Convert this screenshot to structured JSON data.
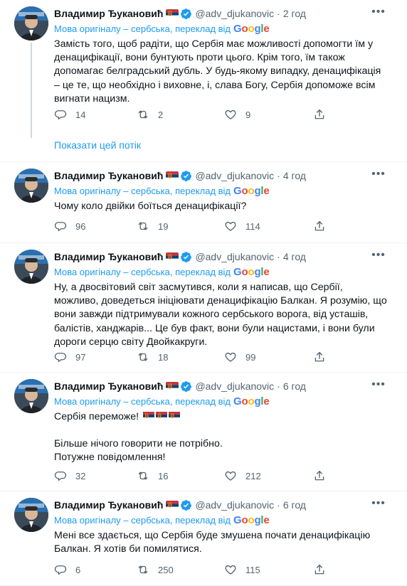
{
  "translate_label": "Мова оригіналу – сербська, переклад від",
  "google": [
    "G",
    "o",
    "o",
    "g",
    "l",
    "e"
  ],
  "show_thread": "Показати цей потік",
  "tweets": [
    {
      "name": "Владимир Ђукановић",
      "handle": "@adv_djukanovic",
      "time": "2 год",
      "text": [
        "Замість того, щоб радіти, що Сербія має можливості допомогти їм у денацифікації, вони бунтують проти цього. Крім того, їм також допомагає белградський дубль. У будь-якому випадку, денацифікація – це те, що необхідно і виховне, і, слава Богу, Сербія допоможе всім вигнати нацизм."
      ],
      "replies": "14",
      "retweets": "2",
      "likes": "9"
    },
    {
      "name": "Владимир Ђукановић",
      "handle": "@adv_djukanovic",
      "time": "4 год",
      "text": [
        "Чому коло двійки боїться денацифікації?"
      ],
      "replies": "96",
      "retweets": "19",
      "likes": "114"
    },
    {
      "name": "Владимир Ђукановић",
      "handle": "@adv_djukanovic",
      "time": "4 год",
      "text": [
        "Ну, а двосвітовий світ засмутився, коли я написав, що Сербії, можливо, доведеться ініціювати денацифікацію Балкан. Я розумію, що вони завжди підтримували кожного сербського ворога, від усташів, балістів, ханджарів... Це був факт, вони були нацистами, і вони були дороги серцю світу Двойкакруги."
      ],
      "replies": "97",
      "retweets": "18",
      "likes": "99"
    },
    {
      "name": "Владимир Ђукановић",
      "handle": "@adv_djukanovic",
      "time": "6 год",
      "text": [
        "Сербія переможе!",
        "",
        "Більше нічого говорити не потрібно.",
        "Потужне повідомлення!"
      ],
      "replies": "32",
      "retweets": "16",
      "likes": "212"
    },
    {
      "name": "Владимир Ђукановић",
      "handle": "@adv_djukanovic",
      "time": "6 год",
      "text": [
        "Мені все здається, що Сербія буде змушена почати денацифікацію Балкан. Я хотів би помилятися."
      ],
      "replies": "6",
      "retweets": "250",
      "likes": "115"
    }
  ]
}
